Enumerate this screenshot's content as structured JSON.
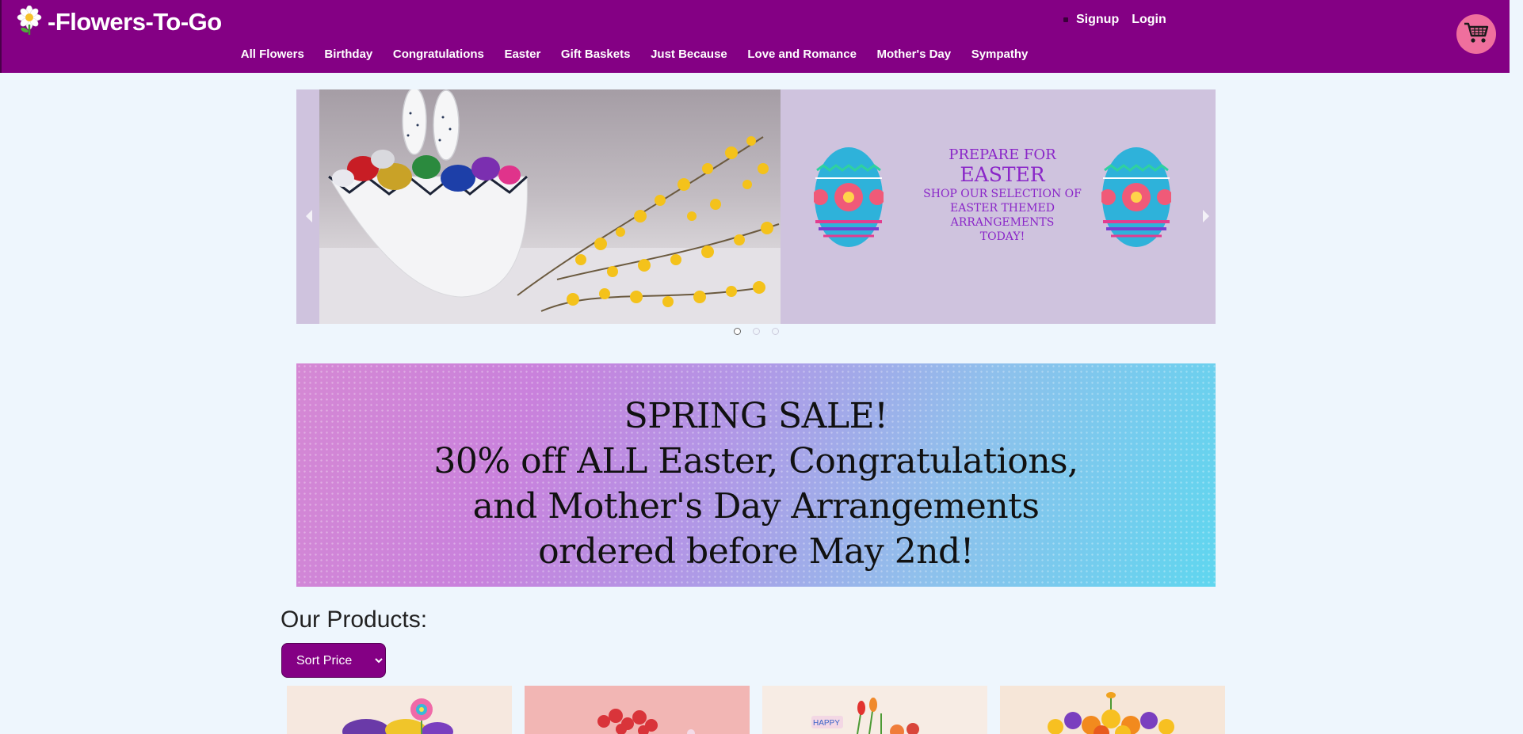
{
  "site": {
    "brand": "-Flowers-To-Go"
  },
  "auth": {
    "signup": "Signup",
    "login": "Login"
  },
  "nav": {
    "items": [
      "All Flowers",
      "Birthday",
      "Congratulations",
      "Easter",
      "Gift Baskets",
      "Just Because",
      "Love and Romance",
      "Mother's Day",
      "Sympathy"
    ]
  },
  "carousel": {
    "promo": {
      "line1": "PREPARE FOR",
      "line2": "EASTER",
      "line3": "SHOP OUR SELECTION OF",
      "line4": "EASTER THEMED ARRANGEMENTS",
      "line5": "TODAY!"
    },
    "slides_total": 3,
    "active_slide": 1
  },
  "banner": {
    "line1": "SPRING SALE!",
    "line2": "30% off ALL Easter, Congratulations,",
    "line3": "and Mother's Day Arrangements",
    "line4": "ordered before May 2nd!"
  },
  "products": {
    "title": "Our Products:",
    "sort_label": "Sort Price"
  },
  "colors": {
    "header": "#840084",
    "page_bg": "#eef6fd",
    "cart_button": "#ef6f9d",
    "promo_text": "#8a26c8"
  },
  "icons": {
    "logo": "daisy-flower-icon",
    "cart": "shopping-cart-icon"
  }
}
